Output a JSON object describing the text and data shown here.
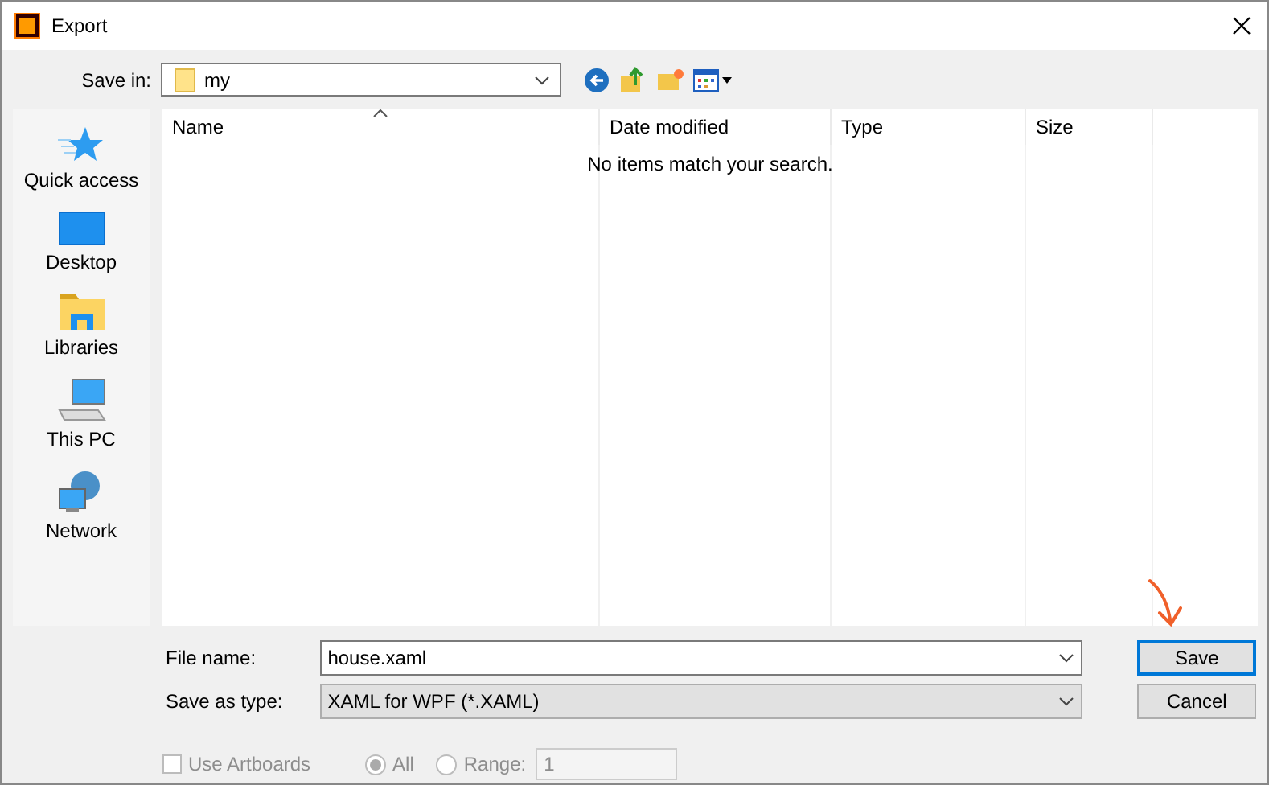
{
  "window": {
    "title": "Export"
  },
  "save_in": {
    "label": "Save in:",
    "value": "my"
  },
  "sidebar": {
    "items": [
      {
        "label": "Quick access",
        "kind": "star"
      },
      {
        "label": "Desktop",
        "kind": "desktop"
      },
      {
        "label": "Libraries",
        "kind": "libraries"
      },
      {
        "label": "This PC",
        "kind": "pc"
      },
      {
        "label": "Network",
        "kind": "network"
      }
    ]
  },
  "file_list": {
    "columns": [
      {
        "label": "Name",
        "sorted": true
      },
      {
        "label": "Date modified",
        "sorted": false
      },
      {
        "label": "Type",
        "sorted": false
      },
      {
        "label": "Size",
        "sorted": false
      }
    ],
    "empty_message": "No items match your search."
  },
  "file_name": {
    "label": "File name:",
    "value": "house.xaml"
  },
  "save_as_type": {
    "label": "Save as type:",
    "value": "XAML for WPF (*.XAML)"
  },
  "buttons": [
    {
      "label": "Save",
      "default": true
    },
    {
      "label": "Cancel",
      "default": false
    }
  ],
  "options": {
    "disabled": true,
    "use_artboards": {
      "label": "Use Artboards",
      "checked": false
    },
    "all": {
      "label": "All",
      "selected": true
    },
    "range": {
      "label": "Range:",
      "selected": false,
      "value": "1"
    }
  }
}
